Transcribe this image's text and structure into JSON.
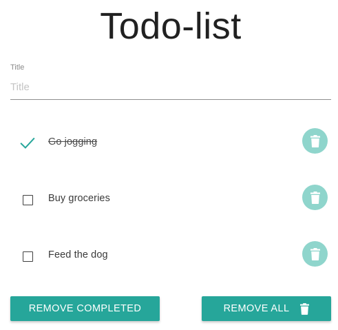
{
  "app": {
    "title": "Todo-list"
  },
  "form": {
    "title_label": "Title",
    "title_placeholder": "Title",
    "title_value": ""
  },
  "todos": [
    {
      "text": "Go jogging",
      "completed": true
    },
    {
      "text": "Buy groceries",
      "completed": false
    },
    {
      "text": "Feed the dog",
      "completed": false
    }
  ],
  "icons": {
    "check": "check-icon",
    "checkbox": "checkbox-unchecked-icon",
    "delete": "trash-icon"
  },
  "actions": {
    "remove_completed_label": "REMOVE COMPLETED",
    "remove_all_label": "REMOVE ALL"
  },
  "colors": {
    "accent": "#26a69a",
    "delete_button": "#8fd5cc",
    "check": "#26a69a"
  }
}
